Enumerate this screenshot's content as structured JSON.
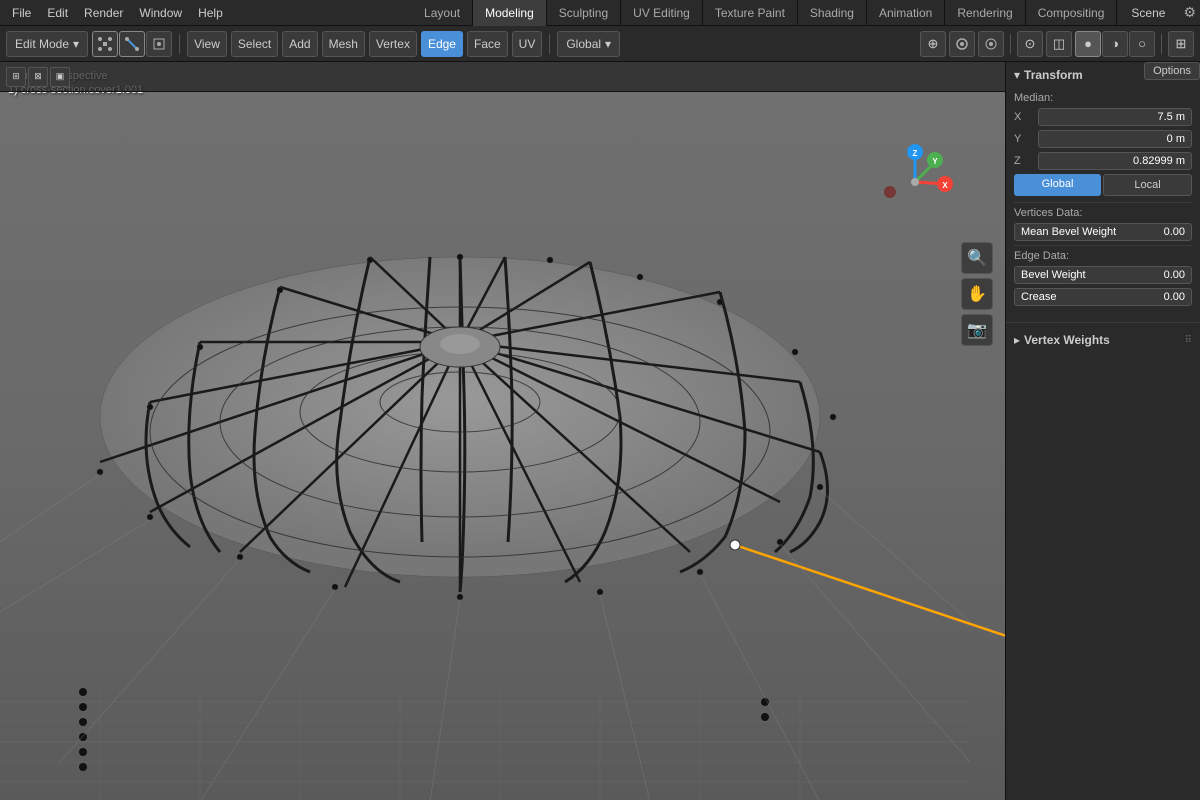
{
  "topMenu": {
    "items": [
      "File",
      "Edit",
      "Render",
      "Window",
      "Help"
    ],
    "workspaces": [
      "Layout",
      "Modeling",
      "Sculpting",
      "UV Editing",
      "Texture Paint",
      "Shading",
      "Animation",
      "Rendering",
      "Compositing"
    ],
    "activeWorkspace": "Modeling",
    "sceneLabel": "Scene"
  },
  "toolbar": {
    "editModeLabel": "Edit Mode",
    "viewLabel": "View",
    "selectLabel": "Select",
    "addLabel": "Add",
    "meshLabel": "Mesh",
    "vertexLabel": "Vertex",
    "edgeLabel": "Edge",
    "faceLabel": "Face",
    "uvLabel": "UV",
    "globalLabel": "Global",
    "vertexModeIcon": "vertex",
    "edgeModeIcon": "edge",
    "faceModeIcon": "face"
  },
  "viewport": {
    "cameraLabel": "Camera Perspective",
    "objectLabel": "1) cross-section.cover1.001"
  },
  "transform": {
    "sectionTitle": "Transform",
    "medianLabel": "Median:",
    "xLabel": "X",
    "yLabel": "Y",
    "zLabel": "Z",
    "xValue": "7.5 m",
    "yValue": "0 m",
    "zValue": "0.82999 m",
    "globalBtn": "Global",
    "localBtn": "Local",
    "verticesDataLabel": "Vertices Data:",
    "meanBevelWeightLabel": "Mean Bevel Weight",
    "meanBevelWeightValue": "0.00",
    "edgeDataLabel": "Edge Data:",
    "bevelWeightLabel": "Bevel Weight",
    "bevelWeightValue": "0.00",
    "creaseLabel": "Crease",
    "creaseValue": "0.00"
  },
  "vertexWeights": {
    "sectionTitle": "Vertex Weights"
  },
  "icons": {
    "collapse": "▾",
    "expand": "▸",
    "drag": "⠿",
    "chevronDown": "▾",
    "cursor": "✛",
    "hand": "✋",
    "camera": "📷",
    "zoom": "🔍"
  },
  "colors": {
    "accent": "#4a90d9",
    "panelBg": "#2a2a2a",
    "inputBg": "#3a3a3a",
    "border": "#555",
    "activeTab": "#3d3d3d",
    "selectedEdge": "#ffa500",
    "white": "#ffffff"
  }
}
